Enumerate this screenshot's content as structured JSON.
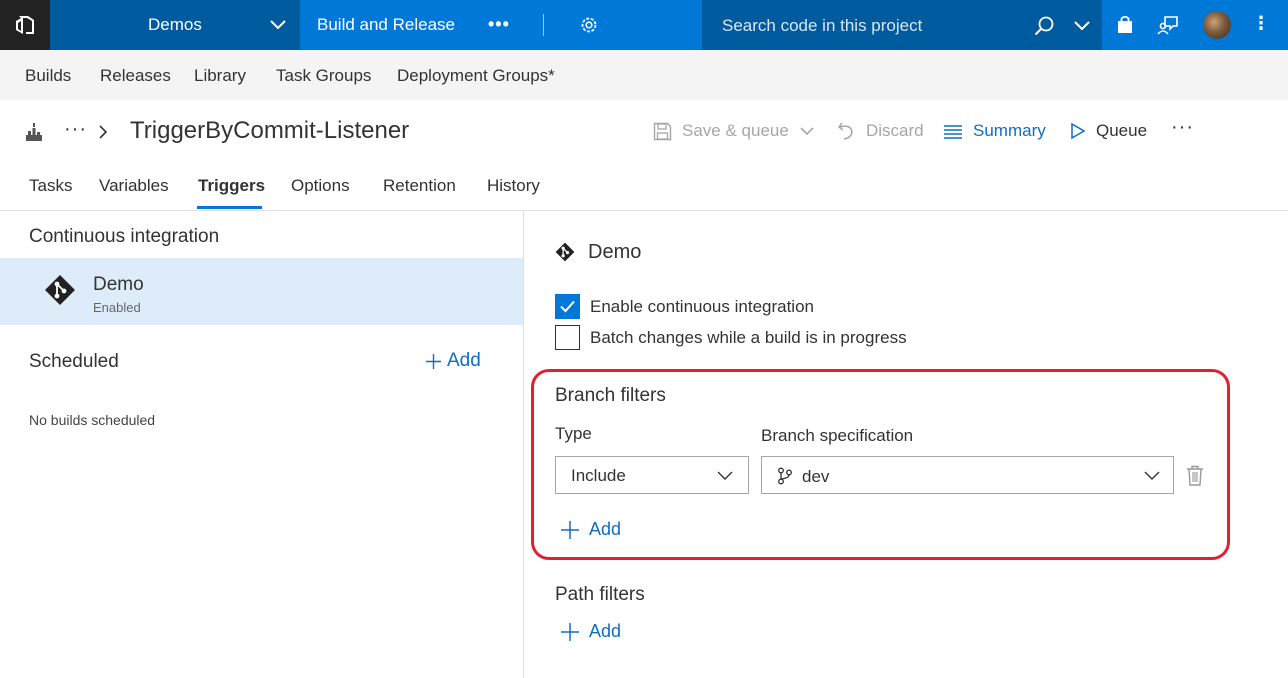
{
  "topbar": {
    "project": "Demos",
    "hub": "Build and Release",
    "search_placeholder": "Search code in this project"
  },
  "hubnav": {
    "items": [
      "Builds",
      "Releases",
      "Library",
      "Task Groups",
      "Deployment Groups*"
    ]
  },
  "header": {
    "breadcrumb_more": "···",
    "title": "TriggerByCommit-Listener",
    "toolbar": {
      "save_queue": "Save & queue",
      "discard": "Discard",
      "summary": "Summary",
      "queue": "Queue",
      "more": "···"
    }
  },
  "tabs": [
    "Tasks",
    "Variables",
    "Triggers",
    "Options",
    "Retention",
    "History"
  ],
  "left": {
    "ci_heading": "Continuous integration",
    "ci_item": {
      "name": "Demo",
      "status": "Enabled"
    },
    "scheduled_heading": "Scheduled",
    "scheduled_add": "Add",
    "scheduled_empty": "No builds scheduled"
  },
  "right": {
    "repo_title": "Demo",
    "enable_ci": {
      "label": "Enable continuous integration",
      "checked": true
    },
    "batch_changes": {
      "label": "Batch changes while a build is in progress",
      "checked": false
    },
    "branch_filters": {
      "heading": "Branch filters",
      "type_label": "Type",
      "spec_label": "Branch specification",
      "type_value": "Include",
      "spec_value": "dev",
      "add": "Add"
    },
    "path_filters": {
      "heading": "Path filters",
      "add": "Add"
    }
  },
  "colors": {
    "accent": "#0078d7",
    "accent_dark": "#005a9e",
    "link": "#106ebe",
    "selected_row": "#deecf9",
    "highlight": "#e3202e"
  }
}
